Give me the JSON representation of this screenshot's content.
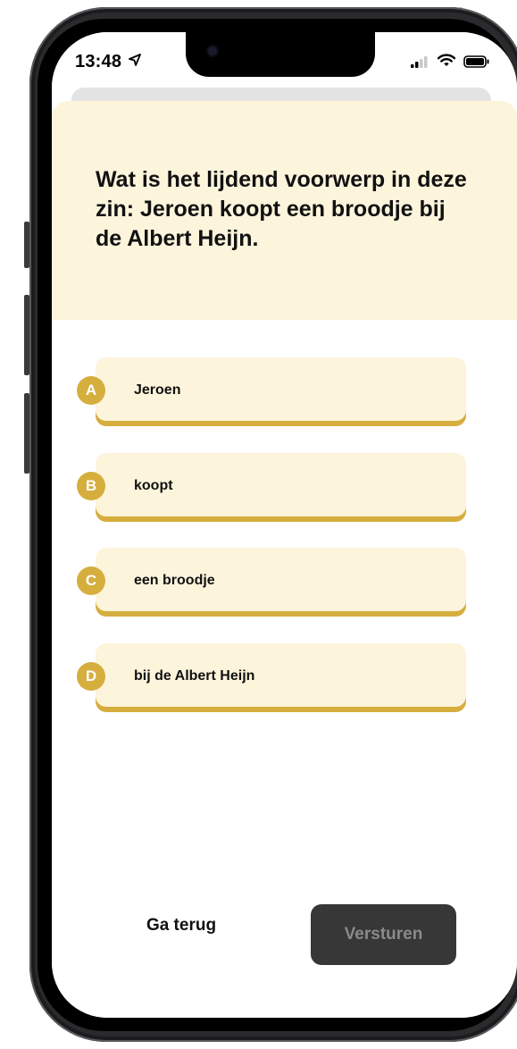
{
  "status_bar": {
    "time": "13:48",
    "location_icon": "location-arrow-icon",
    "signal_icon": "cellular-signal-icon",
    "wifi_icon": "wifi-icon",
    "battery_icon": "battery-icon"
  },
  "quiz": {
    "question": "Wat is het lijdend voorwerp in deze zin: Jeroen koopt een broodje bij de Albert Heijn.",
    "options": [
      {
        "letter": "A",
        "label": "Jeroen"
      },
      {
        "letter": "B",
        "label": "koopt"
      },
      {
        "letter": "C",
        "label": "een broodje"
      },
      {
        "letter": "D",
        "label": "bij de Albert Heijn"
      }
    ]
  },
  "actions": {
    "back_label": "Ga terug",
    "submit_label": "Versturen",
    "submit_enabled": false
  },
  "colors": {
    "accent": "#d6ae3e",
    "card_background": "#fdf4dc",
    "submit_background": "#373737",
    "submit_text": "#8a8a8a"
  }
}
